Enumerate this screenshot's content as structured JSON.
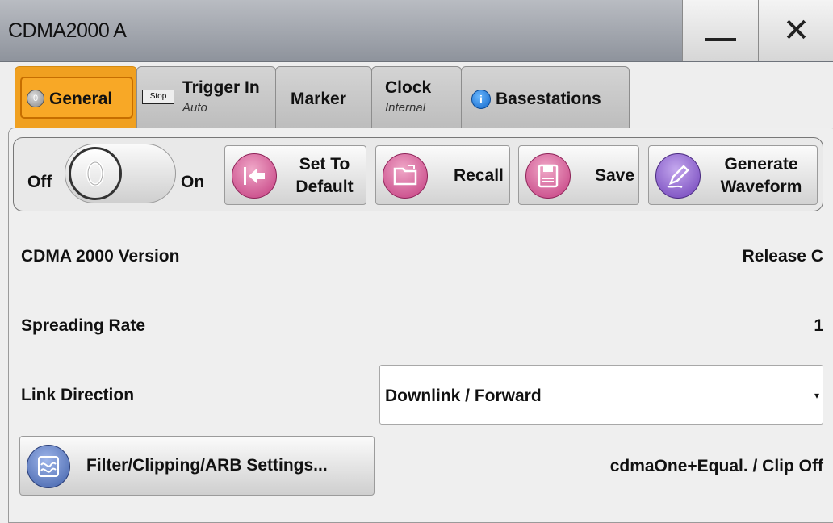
{
  "window": {
    "title": "CDMA2000 A",
    "minimize_icon": "minimize-icon",
    "close_icon": "close-icon",
    "close_glyph": "✕"
  },
  "tabs": [
    {
      "label": "General",
      "icon": "status-off-icon",
      "active": true
    },
    {
      "label": "Trigger In",
      "sub": "Auto",
      "badge": "Stop"
    },
    {
      "label": "Marker"
    },
    {
      "label": "Clock",
      "sub": "Internal"
    },
    {
      "label": "Basestations",
      "icon": "info-icon"
    }
  ],
  "toolbar": {
    "off_label": "Off",
    "on_label": "On",
    "state": "off",
    "set_default_line1": "Set To",
    "set_default_line2": "Default",
    "recall_label": "Recall",
    "save_label": "Save",
    "generate_line1": "Generate",
    "generate_line2": "Waveform"
  },
  "settings": {
    "version_label": "CDMA 2000 Version",
    "version_value": "Release C",
    "spreading_label": "Spreading Rate",
    "spreading_value": "1",
    "link_label": "Link Direction",
    "link_value": "Downlink / Forward",
    "filter_button": "Filter/Clipping/ARB Settings...",
    "filter_value": "cdmaOne+Equal. / Clip Off"
  },
  "colors": {
    "active_tab": "#f0a020",
    "accent_pink": "#c23a7e",
    "accent_purple": "#6e3fb8",
    "accent_blue": "#3f5fa8",
    "titlebar": "#9aa0a8"
  }
}
